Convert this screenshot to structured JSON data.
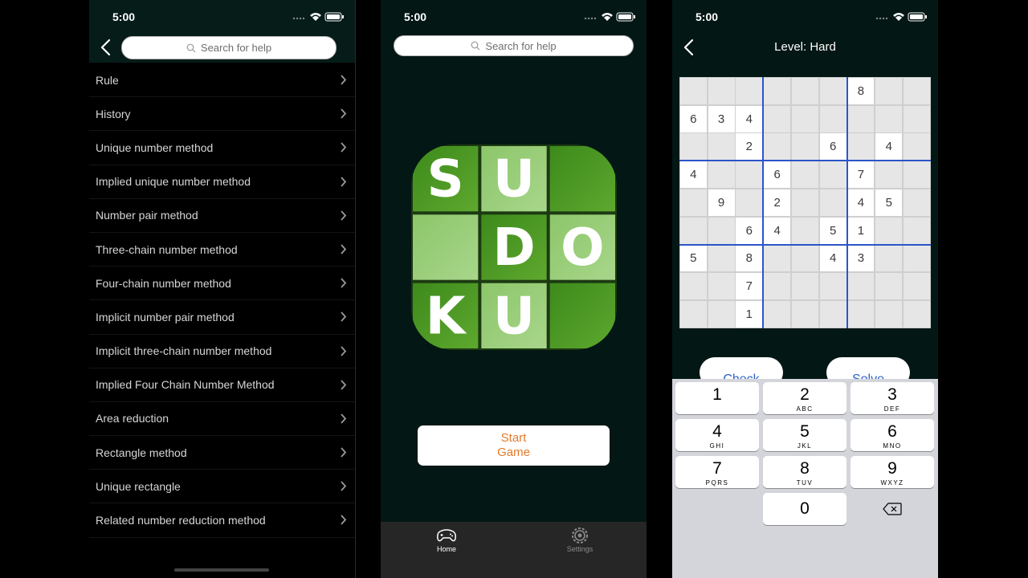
{
  "status_time": "5:00",
  "help_screen": {
    "search_placeholder": "Search for help",
    "items": [
      "Rule",
      "History",
      "Unique number method",
      "Implied unique number method",
      "Number pair method",
      "Three-chain number method",
      "Four-chain number method",
      "Implicit number pair method",
      "Implicit three-chain number method",
      "Implied Four Chain Number Method",
      "Area reduction",
      "Rectangle method",
      "Unique rectangle",
      "Related number reduction method"
    ]
  },
  "home_screen": {
    "search_placeholder": "Search for help",
    "logo_letters": [
      "S",
      "U",
      "",
      "",
      "D",
      "O",
      "K",
      "U",
      ""
    ],
    "start_label": "Start Game",
    "tabs": [
      {
        "label": "Home",
        "icon": "gamepad-icon",
        "active": true
      },
      {
        "label": "Settings",
        "icon": "gear-icon",
        "active": false
      }
    ]
  },
  "game_screen": {
    "title": "Level: Hard",
    "grid": [
      [
        "",
        "",
        "",
        "",
        "",
        "",
        "8",
        "",
        ""
      ],
      [
        "6",
        "3",
        "4",
        "",
        "",
        "",
        "",
        "",
        ""
      ],
      [
        "",
        "",
        "2",
        "",
        "",
        "6",
        "",
        "4",
        ""
      ],
      [
        "4",
        "",
        "",
        "6",
        "",
        "",
        "7",
        "",
        ""
      ],
      [
        "",
        "9",
        "",
        "2",
        "",
        "",
        "4",
        "5",
        ""
      ],
      [
        "",
        "",
        "6",
        "4",
        "",
        "5",
        "1",
        "",
        ""
      ],
      [
        "5",
        "",
        "8",
        "",
        "",
        "4",
        "3",
        "",
        ""
      ],
      [
        "",
        "",
        "7",
        "",
        "",
        "",
        "",
        "",
        ""
      ],
      [
        "",
        "",
        "1",
        "",
        "",
        "",
        "",
        "",
        ""
      ]
    ],
    "check_label": "Check",
    "solve_label": "Solve",
    "keypad": [
      {
        "num": "1",
        "letters": ""
      },
      {
        "num": "2",
        "letters": "ABC"
      },
      {
        "num": "3",
        "letters": "DEF"
      },
      {
        "num": "4",
        "letters": "GHI"
      },
      {
        "num": "5",
        "letters": "JKL"
      },
      {
        "num": "6",
        "letters": "MNO"
      },
      {
        "num": "7",
        "letters": "PQRS"
      },
      {
        "num": "8",
        "letters": "TUV"
      },
      {
        "num": "9",
        "letters": "WXYZ"
      }
    ],
    "zero_key": "0"
  },
  "colors": {
    "dark_background": "#031714",
    "accent_orange": "#e47a2a",
    "button_blue": "#2d63c8",
    "grid_line_blue": "#2c55c8"
  }
}
